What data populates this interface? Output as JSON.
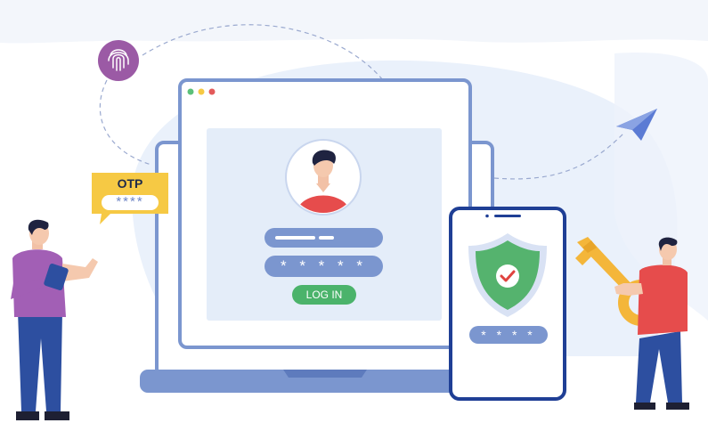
{
  "otp_card": {
    "title": "OTP",
    "code": "****"
  },
  "login_form": {
    "password_mask": "* * * * *",
    "login_button": "LOG IN"
  },
  "phone": {
    "pin_mask": "* * * *"
  },
  "colors": {
    "background_blob": "#eaf1fb",
    "laptop_frame": "#7b96cf",
    "screen_panel": "#e4edf9",
    "login_green": "#4bb36b",
    "shield_green": "#55b36e",
    "phone_border": "#1f3f95",
    "otp_yellow": "#f6c944",
    "fingerprint_purple": "#9b5aa5",
    "key_gold": "#f4b63a"
  },
  "icons": [
    "fingerprint-icon",
    "paper-plane-icon",
    "shield-check-icon",
    "key-icon",
    "user-avatar-icon"
  ]
}
